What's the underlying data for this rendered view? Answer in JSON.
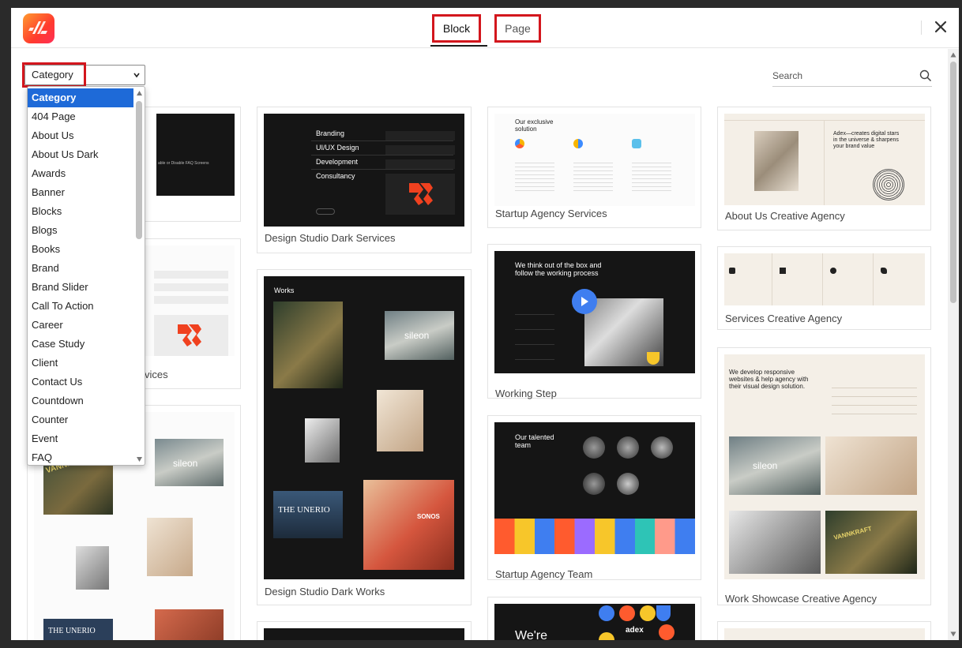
{
  "header": {
    "tabs": [
      {
        "label": "Block",
        "active": true
      },
      {
        "label": "Page",
        "active": false
      }
    ]
  },
  "filter": {
    "selected": "Category",
    "options": [
      "Category",
      "404 Page",
      "About Us",
      "About Us Dark",
      "Awards",
      "Banner",
      "Blocks",
      "Blogs",
      "Books",
      "Brand",
      "Brand Slider",
      "Call To Action",
      "Career",
      "Case Study",
      "Client",
      "Contact Us",
      "Countdown",
      "Counter",
      "Event",
      "FAQ"
    ]
  },
  "search": {
    "placeholder": "Search"
  },
  "cards": {
    "col1_partial_label": "vices",
    "design_studio_dark_services": "Design Studio Dark Services",
    "design_studio_dark_works": "Design Studio Dark Works",
    "startup_agency_services": "Startup Agency Services",
    "working_step": "Working Step",
    "startup_agency_team": "Startup Agency Team",
    "about_us_creative_agency": "About Us Creative Agency",
    "services_creative_agency": "Services Creative Agency",
    "work_showcase_creative_agency": "Work Showcase Creative Agency"
  },
  "thumb_text": {
    "services_list": [
      "Branding",
      "UI/UX Design",
      "Development",
      "Consultancy"
    ],
    "works_title": "Works",
    "startup_services_title": "Our exclusive solution",
    "working_step_title": "We think out of the box and follow the working process",
    "team_title": "Our talented team",
    "about_title": "Adex—creates digital stars in the universe & sharpens your brand value",
    "showcase_title": "We develop responsive websites & help agency with their visual design solution.",
    "brand_sileon": "sileon",
    "brand_unerio": "THE UNERIO",
    "brand_vannkraft": "VANNKRAFT",
    "brand_sonos": "SONOS",
    "brand_adex": "adex",
    "brand_were": "We're",
    "faq_partial": "able or Disable FAQ Screens"
  },
  "colors": {
    "accent_red": "#d3161d",
    "select_blue": "#1e6ad8",
    "brand_orange": "#ff5b2e"
  }
}
